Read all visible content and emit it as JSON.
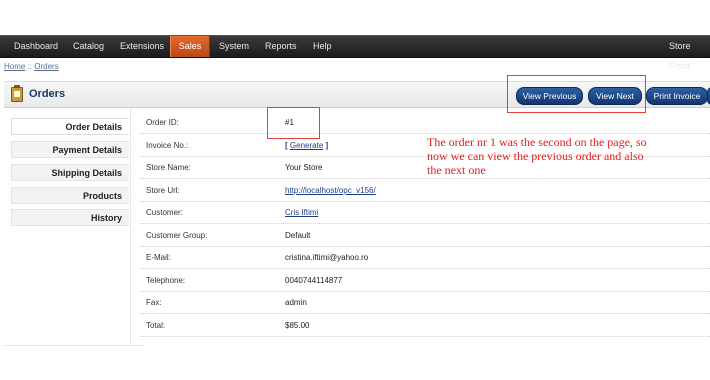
{
  "nav": {
    "items": [
      "Dashboard",
      "Catalog",
      "Extensions",
      "Sales",
      "System",
      "Reports",
      "Help"
    ],
    "active": "Sales",
    "store_front": "Store Front"
  },
  "breadcrumb": {
    "home": "Home",
    "separator": "::",
    "current": "Orders"
  },
  "heading": {
    "title": "Orders",
    "buttons": {
      "view_previous": "View Previous",
      "view_next": "View Next",
      "print_invoice": "Print Invoice"
    }
  },
  "tabs": [
    "Order Details",
    "Payment Details",
    "Shipping Details",
    "Products",
    "History"
  ],
  "active_tab": "Order Details",
  "order_details": {
    "order_id": {
      "label": "Order ID:",
      "value": "#1"
    },
    "invoice": {
      "label": "Invoice No.:",
      "open": "[",
      "link": "Generate",
      "close": "]"
    },
    "store_name": {
      "label": "Store Name:",
      "value": "Your Store"
    },
    "store_url": {
      "label": "Store Url:",
      "value": "http://localhost/opc_v156/"
    },
    "customer": {
      "label": "Customer:",
      "value": "Cris Iftimi"
    },
    "customer_group": {
      "label": "Customer Group:",
      "value": "Default"
    },
    "email": {
      "label": "E-Mail:",
      "value": "cristina.iftimi@yahoo.ro"
    },
    "telephone": {
      "label": "Telephone:",
      "value": "0040744114877"
    },
    "fax": {
      "label": "Fax:",
      "value": "admin"
    },
    "total": {
      "label": "Total:",
      "value": "$85.00"
    }
  },
  "annotation": "The order nr 1 was the second on the page, so now we can view the previous order and also the next one",
  "colors": {
    "nav_bg": "#2a2a2a",
    "nav_active": "#d25a22",
    "button": "#1e4a8c",
    "annotation": "#e02020",
    "highlight_box": "#e0403a"
  }
}
